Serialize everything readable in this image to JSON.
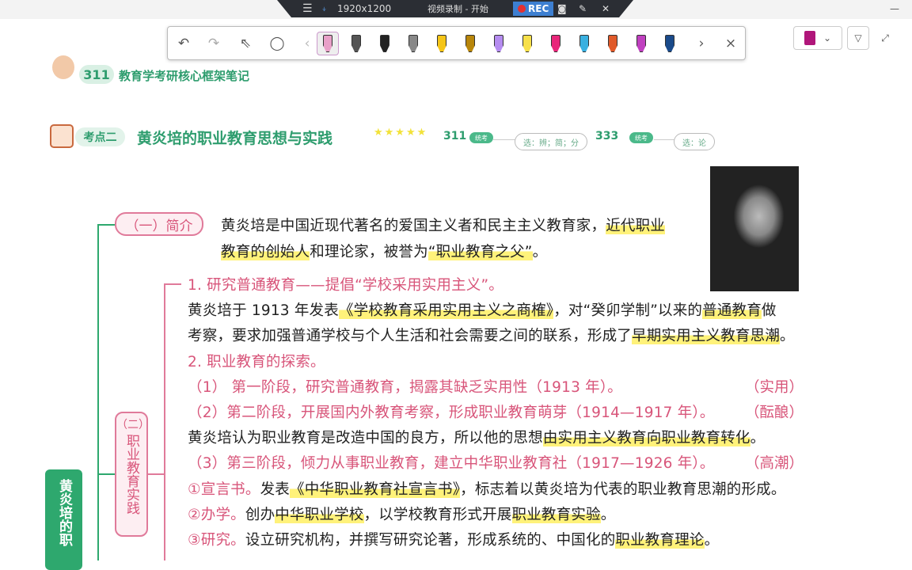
{
  "recorder": {
    "resolution": "1920x1200",
    "title": "视频录制 - 开始",
    "rec_label": "REC"
  },
  "window": {
    "minimize": "—"
  },
  "toolbar": {
    "tools": [
      "undo",
      "redo",
      "pointer",
      "lasso",
      "prev"
    ],
    "pens": [
      "#e8a0c8",
      "#555555",
      "#222222",
      "#888888",
      "#f5c518",
      "#b8860b",
      "#b58cf0",
      "#f7e04a",
      "#e8267a",
      "#3ab0e0",
      "#e05a2a",
      "#c040c0",
      "#1a4a8a"
    ],
    "next": "›",
    "close": "×"
  },
  "header": {
    "badge": "311",
    "title": "教育学考研核心框架笔记"
  },
  "section": {
    "label": "考点二",
    "title": "黄炎培的职业教育思想与实践",
    "stars": "★★★★★",
    "exam1": "311",
    "tag1": "统考",
    "types1": "选：辨；简；分",
    "exam2": "333",
    "tag2": "统考",
    "types2": "选：论"
  },
  "tree": {
    "root": "黄炎培的职",
    "node1": "（一）简介",
    "node2_num": "（二）",
    "node2": "职业教育实践"
  },
  "intro": [
    [
      {
        "t": "黄炎培是中国近现代著名的爱国主义者和民主主义教育家，"
      },
      {
        "t": "近代职业",
        "hl": 1
      }
    ],
    [
      {
        "t": "教育的创始人",
        "hl": 1
      },
      {
        "t": "和理论家，被誉为"
      },
      {
        "t": "“职业教育之父”",
        "hl": 1
      },
      {
        "t": "。"
      }
    ]
  ],
  "lines": [
    {
      "segs": [
        {
          "t": "1. 研究普通教育——提倡“学校采用实用主义”。",
          "pk": 1
        }
      ]
    },
    {
      "segs": [
        {
          "t": "黄炎培于 1913 年发表"
        },
        {
          "t": "《学校教育采用实用主义之商榷》",
          "hl": 1
        },
        {
          "t": "，对“癸卯学制”以来的"
        },
        {
          "t": "普通教育",
          "hl": 1
        },
        {
          "t": "做"
        }
      ]
    },
    {
      "segs": [
        {
          "t": "考察，要求加强普通学校与个人生活和社会需要之间的联系，形成了"
        },
        {
          "t": "早期实用主义教育思潮",
          "hl": 1
        },
        {
          "t": "。"
        }
      ]
    },
    {
      "segs": [
        {
          "t": "2. 职业教育的探索。",
          "pk": 1
        }
      ]
    },
    {
      "segs": [
        {
          "t": "（1） 第一阶段，研究普通教育，揭露其缺乏实用性（1913 年）。",
          "pk": 1
        }
      ],
      "right": "（实用）"
    },
    {
      "segs": [
        {
          "t": "（2）第二阶段，开展国内外教育考察，形成职业教育萌芽（1914—1917 年）。",
          "pk": 1
        }
      ],
      "right": "（酝酿）"
    },
    {
      "segs": [
        {
          "t": "黄炎培认为职业教育是改造中国的良方，所以他的思想"
        },
        {
          "t": "由实用主义教育向职业教育转化",
          "hl": 1
        },
        {
          "t": "。"
        }
      ]
    },
    {
      "segs": [
        {
          "t": "（3）第三阶段，倾力从事职业教育，建立中华职业教育社（1917—1926 年）。",
          "pk": 1
        }
      ],
      "right": "（高潮）"
    },
    {
      "segs": [
        {
          "t": "①宣言书。",
          "pk": 1
        },
        {
          "t": "发表"
        },
        {
          "t": "《中华职业教育社宣言书》",
          "hl": 1
        },
        {
          "t": "，标志着以黄炎培为代表的职业教育思潮的形成。"
        }
      ]
    },
    {
      "segs": [
        {
          "t": "②办学。",
          "pk": 1
        },
        {
          "t": "创办"
        },
        {
          "t": "中华职业学校",
          "hl": 1
        },
        {
          "t": "，以学校教育形式开展"
        },
        {
          "t": "职业教育实验",
          "hl": 1
        },
        {
          "t": "。"
        }
      ]
    },
    {
      "segs": [
        {
          "t": "③研究。",
          "pk": 1
        },
        {
          "t": "设立研究机构，并撰写研究论著，形成系统的、中国化的"
        },
        {
          "t": "职业教育理论",
          "hl": 1
        },
        {
          "t": "。"
        }
      ]
    }
  ]
}
